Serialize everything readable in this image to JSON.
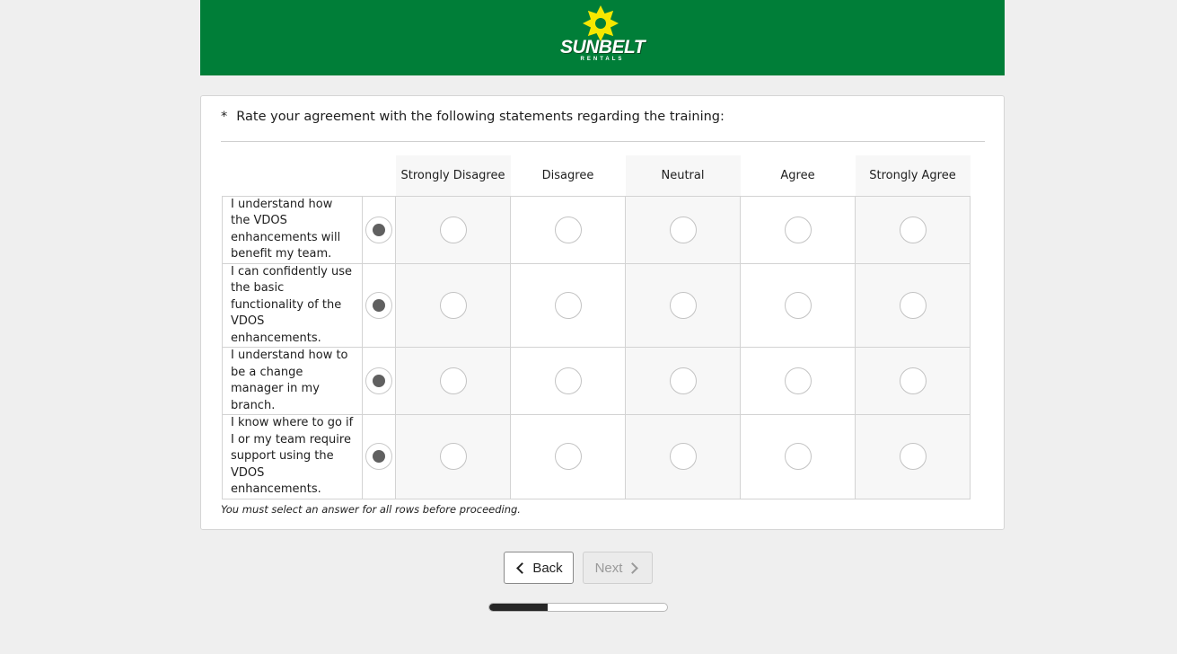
{
  "brand": {
    "name": "SUNBELT",
    "sub": "RENTALS",
    "icon": "sun-logo-icon",
    "banner_color": "#007e38",
    "sun_color": "#f6e700"
  },
  "question": {
    "required_marker": "*",
    "text": "Rate your agreement with the following statements regarding the training:"
  },
  "scale": [
    "Strongly Disagree",
    "Disagree",
    "Neutral",
    "Agree",
    "Strongly Agree"
  ],
  "statements": [
    "I understand how the VDOS enhancements will benefit my team.",
    "I can confidently use the basic functionality of the VDOS enhancements.",
    "I understand how to be a change manager in my branch.",
    "I know where to go if I or my team require support using the VDOS enhancements."
  ],
  "validation_hint": "You must select an answer for all rows before proceeding.",
  "nav": {
    "back_label": "Back",
    "next_label": "Next"
  },
  "progress": {
    "fraction": 0.33
  }
}
